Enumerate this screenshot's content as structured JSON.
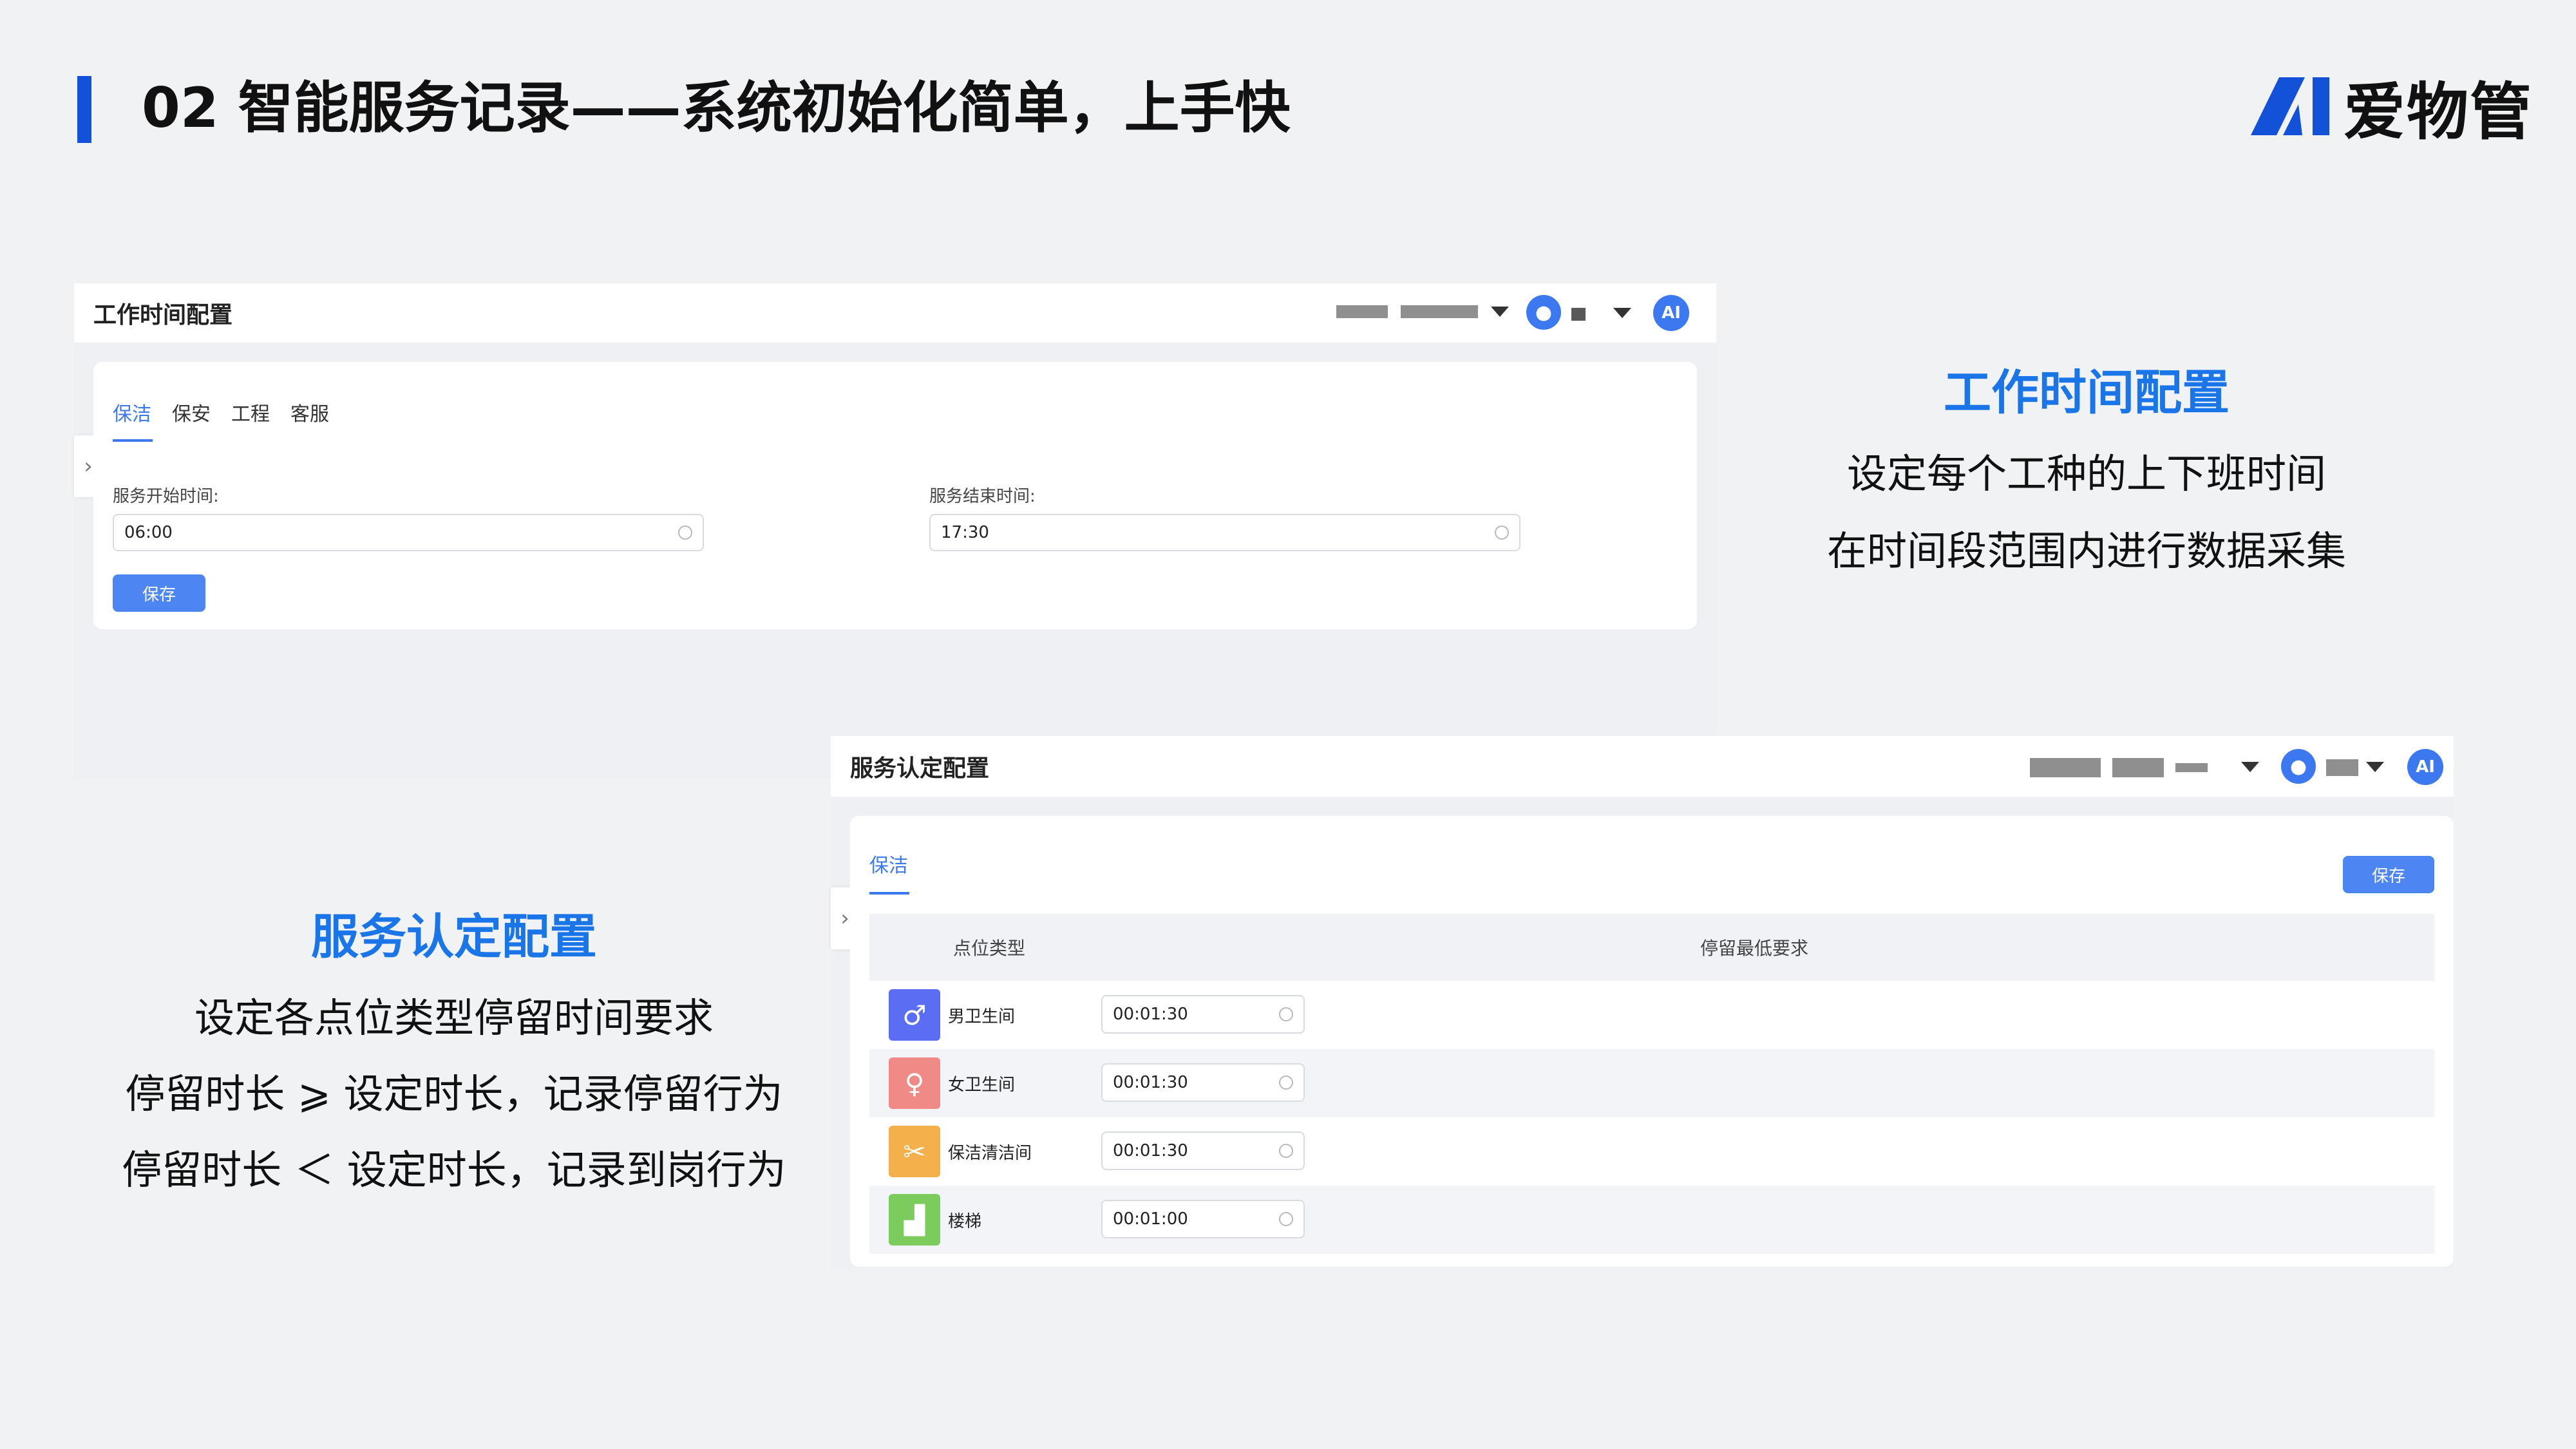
{
  "slide": {
    "title": "02 智能服务记录——系统初始化简单，上手快",
    "logo_mark": "AI",
    "logo_text": "爱物管"
  },
  "worktime_panel": {
    "header_title": "工作时间配置",
    "brand_mark": "AI",
    "tabs": [
      {
        "label": "保洁",
        "active": true
      },
      {
        "label": "保安",
        "active": false
      },
      {
        "label": "工程",
        "active": false
      },
      {
        "label": "客服",
        "active": false
      }
    ],
    "start_label": "服务开始时间:",
    "start_value": "06:00",
    "end_label": "服务结束时间:",
    "end_value": "17:30",
    "save_label": "保存",
    "handle_glyph": "›"
  },
  "service_panel": {
    "header_title": "服务认定配置",
    "brand_mark": "AI",
    "tab": "保洁",
    "save_label": "保存",
    "handle_glyph": "›",
    "columns": [
      "点位类型",
      "停留最低要求"
    ],
    "rows": [
      {
        "type": "男卫生间",
        "value": "00:01:30",
        "icon": "male-restroom-icon",
        "color": "#5b6ef3",
        "glyph": "♂"
      },
      {
        "type": "女卫生间",
        "value": "00:01:30",
        "icon": "female-restroom-icon",
        "color": "#f08a86",
        "glyph": "♀"
      },
      {
        "type": "保洁清洁间",
        "value": "00:01:30",
        "icon": "cleaning-tools-icon",
        "color": "#f4b04a",
        "glyph": "✂"
      },
      {
        "type": "楼梯",
        "value": "00:01:00",
        "icon": "stairs-icon",
        "color": "#7ccc5d",
        "glyph": "▟"
      }
    ]
  },
  "caption_worktime": {
    "title": "工作时间配置",
    "lines": [
      "设定每个工种的上下班时间",
      "在时间段范围内进行数据采集"
    ]
  },
  "caption_service": {
    "title": "服务认定配置",
    "lines": [
      "设定各点位类型停留时间要求",
      "停留时长 ⩾ 设定时长，记录停留行为",
      "停留时长 ＜ 设定时长，记录到岗行为"
    ]
  },
  "colors": {
    "accent": "#1a76e8",
    "primary_button": "#4d86f3",
    "title_bar": "#1351d8"
  }
}
